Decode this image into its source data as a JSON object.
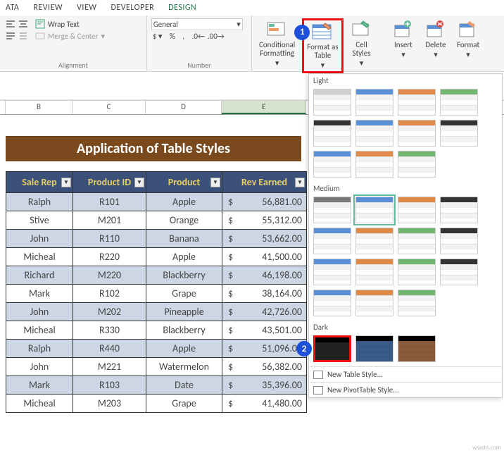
{
  "tabs": {
    "data": "ATA",
    "review": "REVIEW",
    "view": "VIEW",
    "developer": "DEVELOPER",
    "design": "DESIGN"
  },
  "ribbon": {
    "alignment": {
      "wrap": "Wrap Text",
      "merge": "Merge & Center",
      "label": "Alignment"
    },
    "number": {
      "format": "General",
      "label": "Number"
    },
    "styles": {
      "cond": "Conditional\nFormatting",
      "fat": "Format as\nTable",
      "cell": "Cell\nStyles"
    },
    "cells": {
      "insert": "Insert",
      "delete": "Delete",
      "format": "Format"
    }
  },
  "badges": {
    "one": "1",
    "two": "2"
  },
  "cols": {
    "b": "B",
    "c": "C",
    "d": "D",
    "e": "E"
  },
  "title": "Application of Table Styles",
  "headers": {
    "rep": "Sale Rep",
    "pid": "Product ID",
    "prod": "Product",
    "rev": "Rev Earned"
  },
  "rows": [
    {
      "rep": "Ralph",
      "pid": "R101",
      "prod": "Apple",
      "rev": "56,881.00"
    },
    {
      "rep": "Stive",
      "pid": "M201",
      "prod": "Orange",
      "rev": "55,312.00"
    },
    {
      "rep": "John",
      "pid": "R110",
      "prod": "Banana",
      "rev": "53,662.00"
    },
    {
      "rep": "Micheal",
      "pid": "R220",
      "prod": "Apple",
      "rev": "41,500.00"
    },
    {
      "rep": "Richard",
      "pid": "M220",
      "prod": "Blackberry",
      "rev": "46,198.00"
    },
    {
      "rep": "Mark",
      "pid": "R102",
      "prod": "Grape",
      "rev": "38,164.00"
    },
    {
      "rep": "John",
      "pid": "M202",
      "prod": "Pineapple",
      "rev": "42,726.00"
    },
    {
      "rep": "Micheal",
      "pid": "R330",
      "prod": "Blackberry",
      "rev": "43,501.00"
    },
    {
      "rep": "Ralph",
      "pid": "R440",
      "prod": "Apple",
      "rev": "51,096.00"
    },
    {
      "rep": "John",
      "pid": "M221",
      "prod": "Watermelon",
      "rev": "56,382.00"
    },
    {
      "rep": "Mark",
      "pid": "R103",
      "prod": "Date",
      "rev": "35,396.00"
    },
    {
      "rep": "Micheal",
      "pid": "M203",
      "prod": "Grape",
      "rev": "41,480.00"
    }
  ],
  "currency": "$",
  "gallery": {
    "light": "Light",
    "medium": "Medium",
    "dark": "Dark",
    "new_table": "New Table Style...",
    "new_pivot": "New PivotTable Style...",
    "light_colors": [
      "#d0d0d0",
      "#5a8fd6",
      "#e08a4a",
      "#6fb56f",
      "#333",
      "#5a8fd6",
      "#e08a4a",
      "#333",
      "#5a8fd6",
      "#e08a4a",
      "#6fb56f"
    ],
    "medium_colors": [
      "#777",
      "#5a8fd6",
      "#e08a4a",
      "#333",
      "#5a8fd6",
      "#e08a4a",
      "#6fb56f",
      "#333",
      "#5a8fd6",
      "#e08a4a",
      "#6fb56f",
      "#333",
      "#5a8fd6",
      "#e08a4a",
      "#6fb56f"
    ],
    "dark_colors": [
      "#222",
      "#3a5a8a",
      "#8a5a3a"
    ]
  },
  "source": "wsxdn.com"
}
